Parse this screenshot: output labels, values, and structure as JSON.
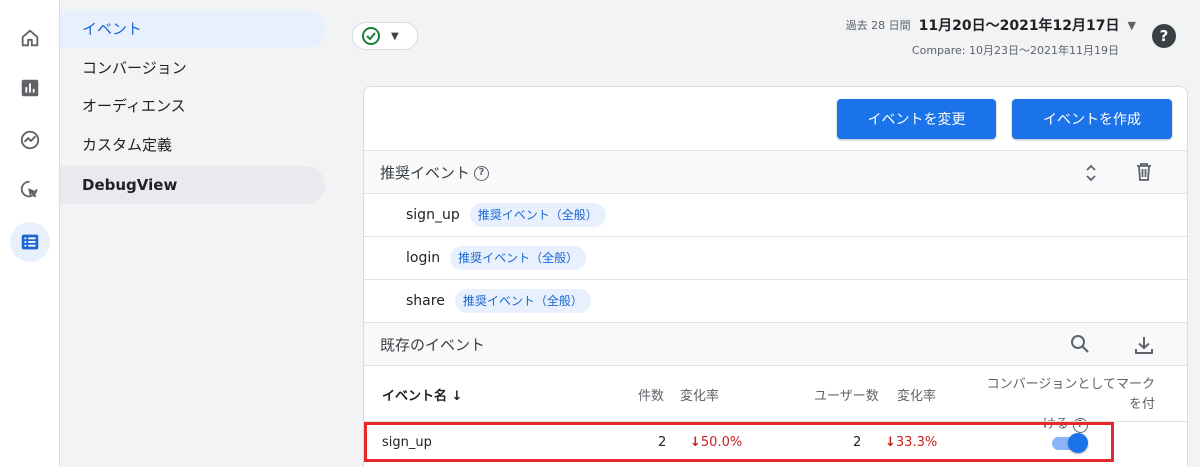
{
  "rail": {
    "items": [
      {
        "name": "home-icon"
      },
      {
        "name": "reports-icon"
      },
      {
        "name": "explore-icon"
      },
      {
        "name": "advertising-icon"
      },
      {
        "name": "configure-icon"
      }
    ]
  },
  "subnav": {
    "items": [
      {
        "label": "イベント"
      },
      {
        "label": "コンバージョン"
      },
      {
        "label": "オーディエンス"
      },
      {
        "label": "カスタム定義"
      },
      {
        "label": "DebugView"
      }
    ]
  },
  "header": {
    "date_preset": "過去 28 日間",
    "date_range": "11月20日～2021年12月17日",
    "compare": "Compare: 10月23日～2021年11月19日",
    "help": "?"
  },
  "toolbar": {
    "modify_event": "イベントを変更",
    "create_event": "イベントを作成"
  },
  "recommended": {
    "title": "推奨イベント",
    "rows": [
      {
        "name": "sign_up",
        "chip": "推奨イベント（全般）"
      },
      {
        "name": "login",
        "chip": "推奨イベント（全般）"
      },
      {
        "name": "share",
        "chip": "推奨イベント（全般）"
      }
    ]
  },
  "existing": {
    "title": "既存のイベント",
    "columns": {
      "event_name": "イベント名",
      "count": "件数",
      "count_change": "変化率",
      "users": "ユーザー数",
      "users_change": "変化率",
      "conversion_line1": "コンバージョンとしてマークを付",
      "conversion_line2": "ける"
    },
    "rows": [
      {
        "name": "sign_up",
        "count": "2",
        "count_change": "50.0%",
        "users": "2",
        "users_change": "33.3%",
        "conversion": true
      }
    ]
  },
  "colors": {
    "accent": "#1a73e8",
    "negative": "#c5221f",
    "highlight": "#e8272b"
  }
}
